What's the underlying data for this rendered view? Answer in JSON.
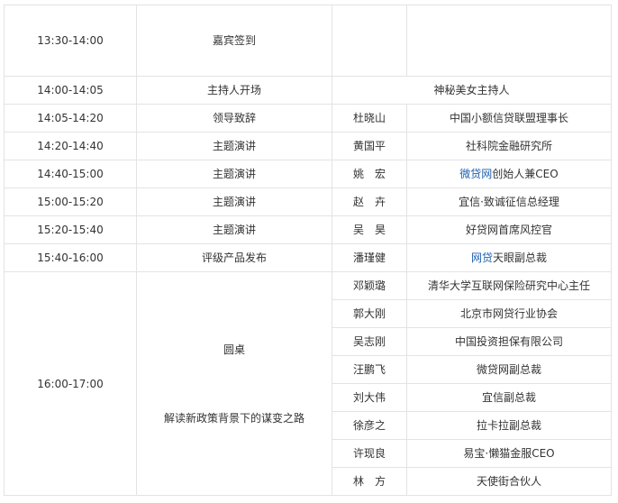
{
  "agenda": [
    {
      "time": "13:30-14:00",
      "topic": "嘉宾签到",
      "name": "",
      "org": ""
    },
    {
      "time": "14:00-14:05",
      "topic": "主持人开场",
      "name": "",
      "org": "神秘美女主持人"
    },
    {
      "time": "14:05-14:20",
      "topic": "领导致辞",
      "name": "杜晓山",
      "org": "中国小额信贷联盟理事长"
    },
    {
      "time": "14:20-14:40",
      "topic": "主题演讲",
      "name": "黄国平",
      "org": "社科院金融研究所"
    },
    {
      "time": "14:40-15:00",
      "topic": "主题演讲",
      "name": "姚　宏",
      "org_link": "微贷网",
      "org_rest": "创始人兼CEO"
    },
    {
      "time": "15:00-15:20",
      "topic": "主题演讲",
      "name": "赵　卉",
      "org": "宜信·致诚征信总经理"
    },
    {
      "time": "15:20-15:40",
      "topic": "主题演讲",
      "name": "吴　昊",
      "org": "好贷网首席风控官"
    },
    {
      "time": "15:40-16:00",
      "topic": "评级产品发布",
      "name": "潘瑾健",
      "org_link": "网贷",
      "org_rest": "天眼副总裁"
    }
  ],
  "roundtable": {
    "time": "16:00-17:00",
    "title": "圆桌",
    "subtitle": "解读新政策背景下的谋变之路",
    "panelists": [
      {
        "name": "邓颖璐",
        "org": "清华大学互联网保险研究中心主任"
      },
      {
        "name": "郭大刚",
        "org": "北京市网贷行业协会"
      },
      {
        "name": "吴志刚",
        "org": "中国投资担保有限公司"
      },
      {
        "name": "汪鹏飞",
        "org": "微贷网副总裁"
      },
      {
        "name": "刘大伟",
        "org": "宜信副总裁"
      },
      {
        "name": "徐彦之",
        "org": "拉卡拉副总裁"
      },
      {
        "name": "许现良",
        "org": "易宝·懒猫金服CEO"
      },
      {
        "name": "林　方",
        "org": "天使街合伙人"
      }
    ]
  },
  "colors": {
    "border": "#e3e3e3",
    "text": "#333333",
    "link": "#1f5faf"
  }
}
